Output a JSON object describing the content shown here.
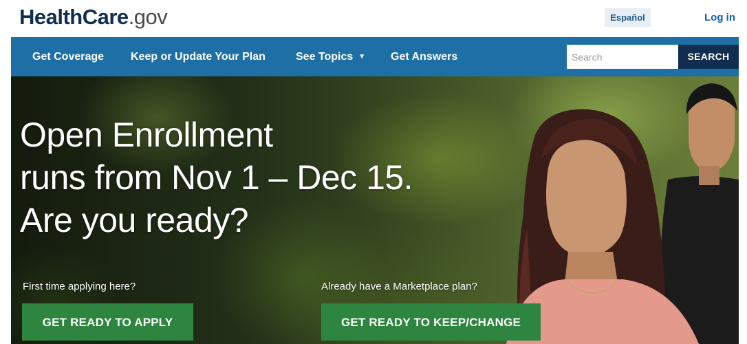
{
  "header": {
    "logo": {
      "brand": "HealthCare",
      "suffix": ".gov"
    },
    "language_button": "Español",
    "login_link": "Log in"
  },
  "nav": {
    "items": [
      {
        "label": "Get Coverage"
      },
      {
        "label": "Keep or Update Your Plan"
      },
      {
        "label": "See Topics",
        "has_dropdown": true,
        "icon": "chevron-down-icon"
      },
      {
        "label": "Get Answers"
      }
    ],
    "search": {
      "placeholder": "Search",
      "value": "",
      "button_label": "SEARCH"
    }
  },
  "hero": {
    "headline": [
      "Open Enrollment",
      "runs from Nov 1 – Dec 15.",
      "Are you ready?"
    ],
    "apply": {
      "prompt": "First time applying here?",
      "button_label": "GET READY TO APPLY"
    },
    "keep_change": {
      "prompt": "Already have a Marketplace plan?",
      "button_label": "GET READY TO KEEP/CHANGE"
    }
  },
  "colors": {
    "nav_background": "#1d6fa5",
    "search_button": "#112e51",
    "cta_green": "#2e8540",
    "logo_brand": "#112e51",
    "link_blue": "#0b62b3"
  }
}
